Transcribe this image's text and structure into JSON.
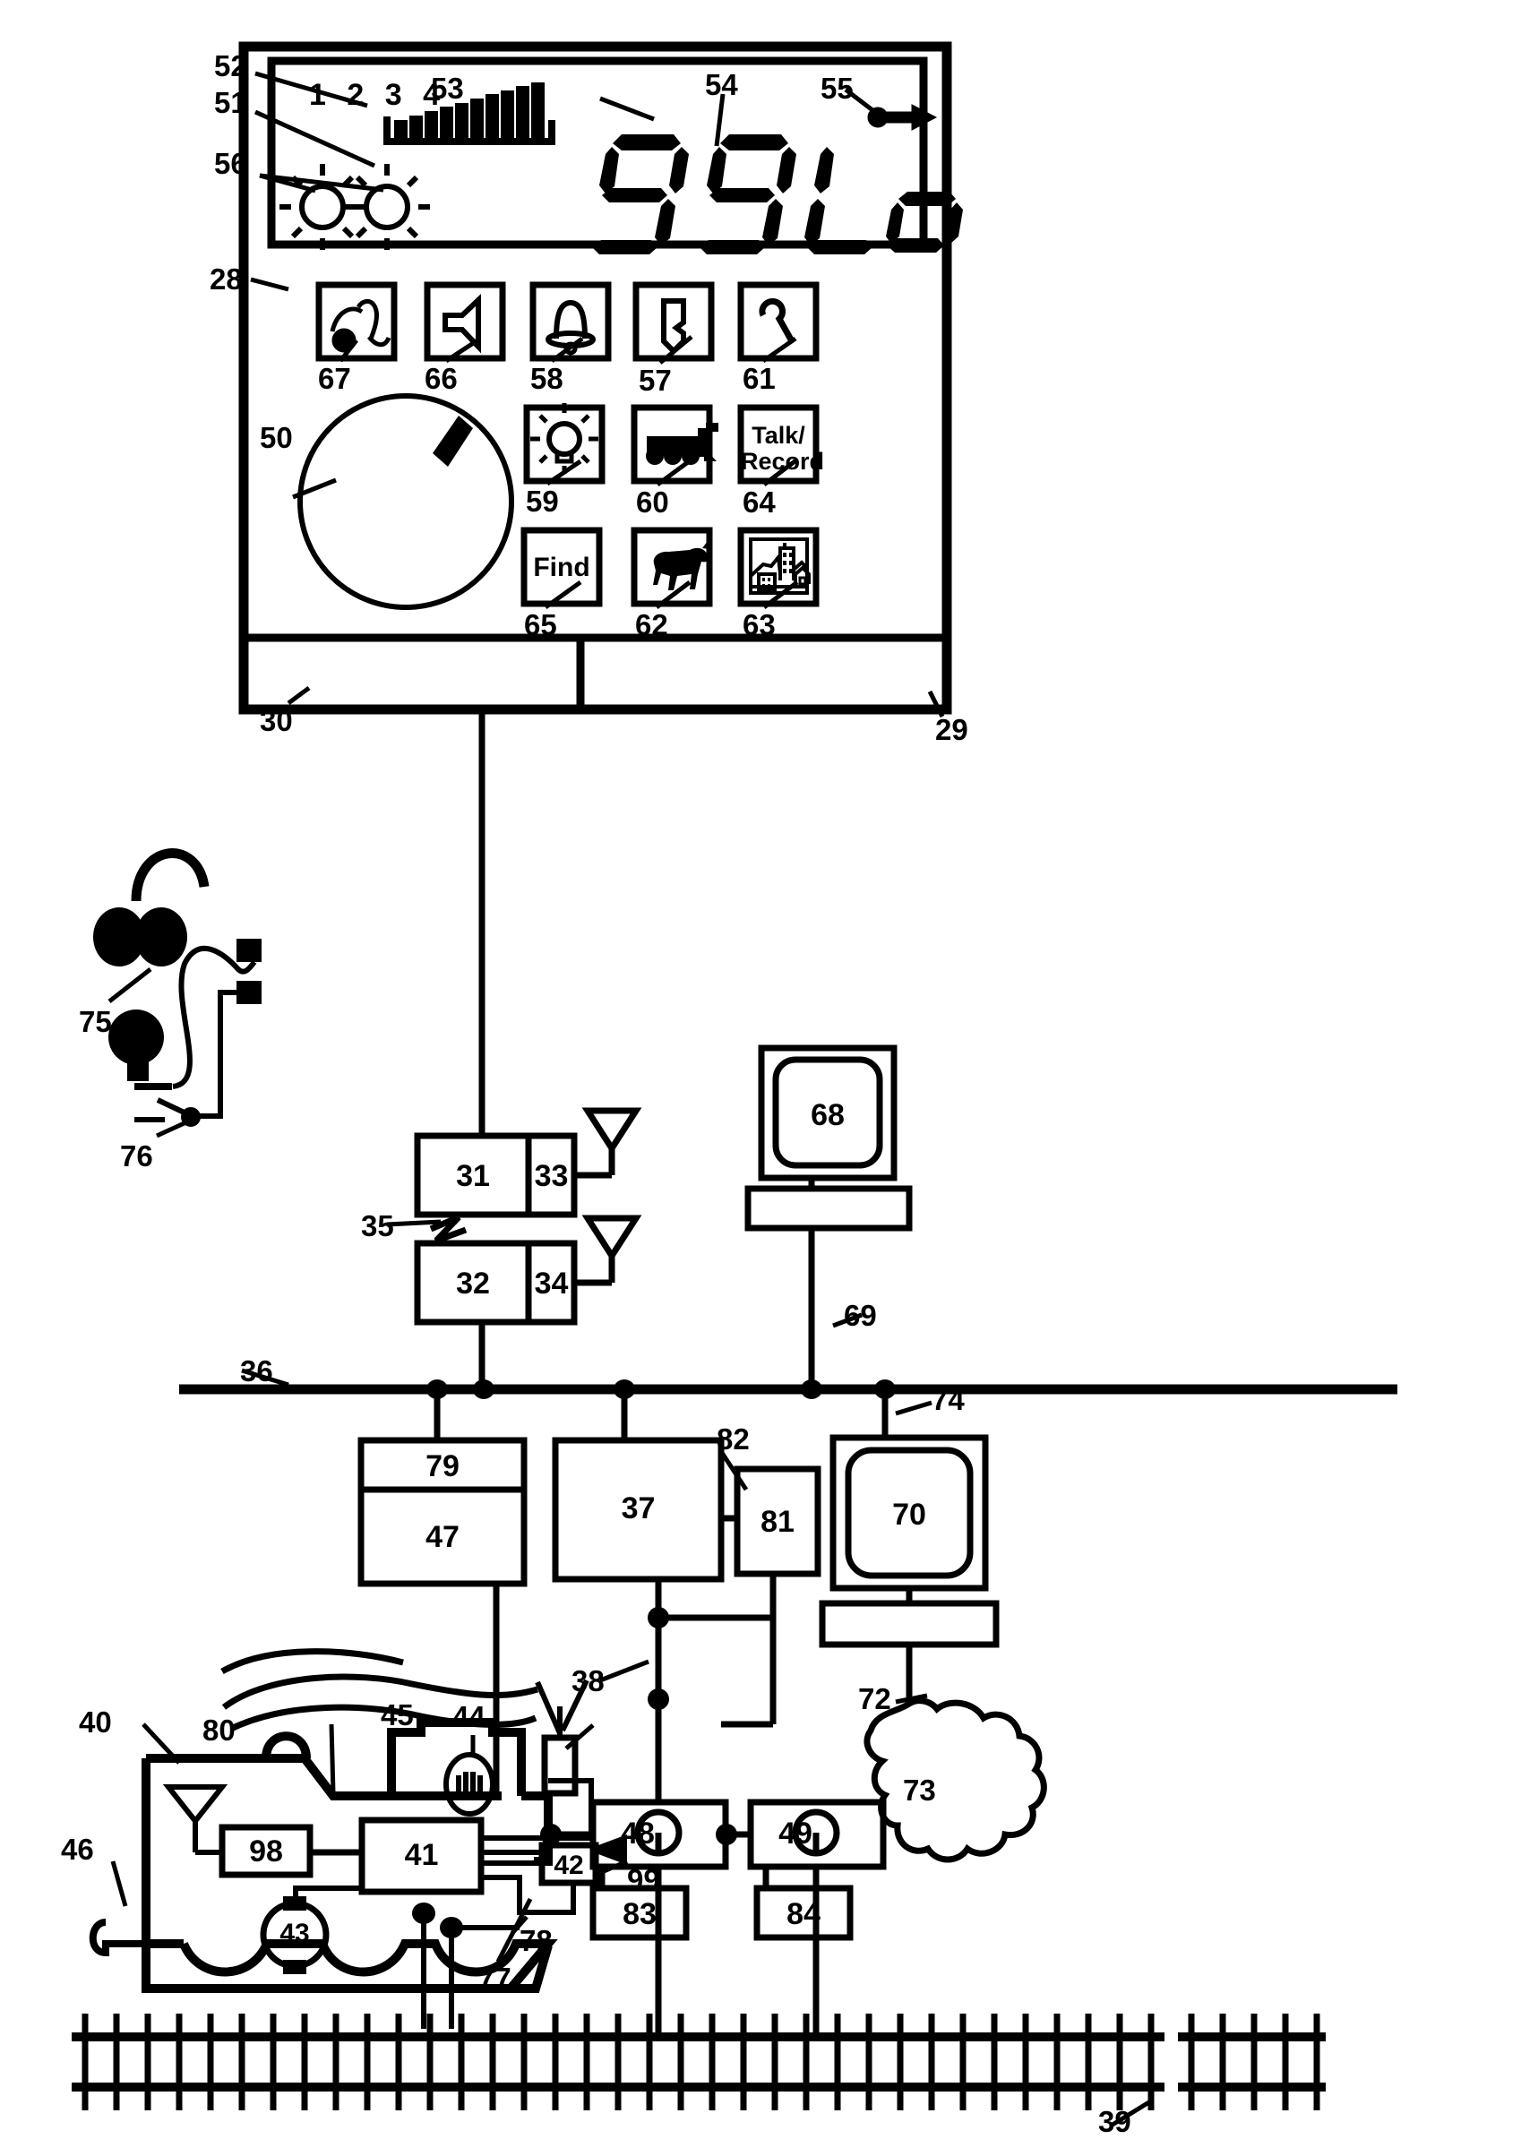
{
  "figure": {
    "title": "Model railroad wireless command control system schematic",
    "type": "patent-line-drawing"
  },
  "controller": {
    "ref_outer": "28",
    "ref_body_right": "29",
    "ref_body_left": "30",
    "lcd": {
      "ref_screen": "51",
      "ref_numbers_row": "52",
      "channel_numbers": "1 2 3 4",
      "ref_bargraph": "53",
      "ref_digits": "54",
      "digits_value": "99Lo",
      "ref_arrow_icon": "55",
      "arrow_icon_name": "direction-arrow-icon",
      "ref_lamp_icons": "56",
      "lamp_icons": [
        "sun-icon",
        "sun-icon"
      ]
    },
    "bargraph": {
      "bars": [
        38,
        44,
        52,
        60,
        66,
        74,
        80,
        86,
        93,
        100
      ]
    },
    "knob": {
      "ref": "50",
      "name": "throttle-dial"
    },
    "buttons": [
      {
        "ref": "67",
        "icon": "whistle-note-icon",
        "label": ""
      },
      {
        "ref": "66",
        "icon": "speaker-icon",
        "label": ""
      },
      {
        "ref": "58",
        "icon": "bell-icon",
        "label": ""
      },
      {
        "ref": "57",
        "icon": "coupler-icon",
        "label": ""
      },
      {
        "ref": "61",
        "icon": "wrench-icon",
        "label": ""
      },
      {
        "ref": "59",
        "icon": "lightbulb-icon",
        "label": ""
      },
      {
        "ref": "60",
        "icon": "locomotive-icon",
        "label": ""
      },
      {
        "ref": "64",
        "icon": "",
        "label": "Talk/\nRecord"
      },
      {
        "ref": "65",
        "icon": "",
        "label": "Find"
      },
      {
        "ref": "62",
        "icon": "cow-icon",
        "label": ""
      },
      {
        "ref": "63",
        "icon": "cityscape-icon",
        "label": ""
      }
    ]
  },
  "headset": {
    "ref_headphones": "75",
    "ref_switch": "76"
  },
  "base_stations": [
    {
      "ref_main": "31",
      "ref_radio": "33",
      "antenna": "antenna-icon"
    },
    {
      "ref_main": "32",
      "ref_radio": "34",
      "antenna": "antenna-icon"
    }
  ],
  "links": {
    "ref_wireless_break": "35",
    "ref_bus": "36",
    "ref_branch": "38",
    "ref_monitor_line": "69",
    "ref_monitor_line_right": "74",
    "ref_cable_72": "72",
    "ref_cloud": "73",
    "ref_track": "39"
  },
  "modules": [
    {
      "ref": "79",
      "position": "top-strip"
    },
    {
      "ref": "47",
      "position": "under-79"
    },
    {
      "ref": "37",
      "position": "center"
    },
    {
      "ref": "81",
      "position": "right-of-37"
    },
    {
      "ref": "82",
      "position": "leader-to-81"
    },
    {
      "ref": "48",
      "position": "lower-left-block"
    },
    {
      "ref": "49",
      "position": "lower-right-block"
    },
    {
      "ref": "83",
      "position": "under-48"
    },
    {
      "ref": "84",
      "position": "under-49"
    },
    {
      "ref": "68",
      "position": "monitor-upper"
    },
    {
      "ref": "70",
      "position": "monitor-lower"
    }
  ],
  "locomotive": {
    "ref_body": "40",
    "ref_coupler": "46",
    "ref_roof_line": "80",
    "ref_antenna_module": "98",
    "ref_controller": "41",
    "ref_aux": "42",
    "ref_motor": "43",
    "ref_speaker": "44",
    "ref_stack": "45",
    "ref_wheel_contact_a": "77",
    "ref_wheel_contact_b": "78",
    "ref_light": "99"
  }
}
